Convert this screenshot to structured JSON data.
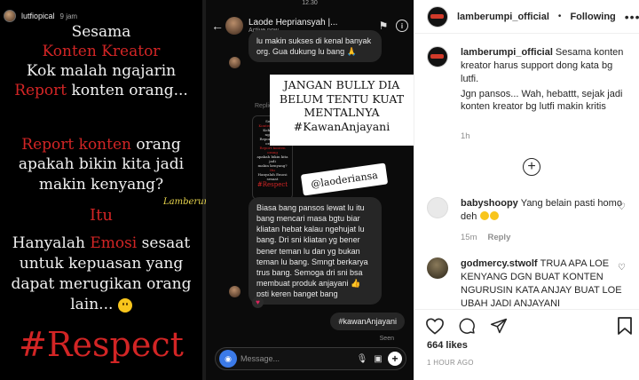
{
  "story": {
    "username": "lutfiopical",
    "time": "9 jam",
    "line1": "Sesama",
    "line2": "Konten Kreator",
    "line3": "Kok malah ngajarin",
    "line4_red": "Report",
    "line4_rest": " konten orang...",
    "line5_red": "Report konten",
    "line5_rest": " orang",
    "line6": "apakah bikin kita jadi",
    "line7": "makin kenyang?",
    "line8": "Itu",
    "line9_pre": "Hanyalah ",
    "line9_red": "Emosi",
    "line9_post": " sesaat",
    "line10": "untuk kepuasan yang",
    "line11": "dapat merugikan orang",
    "line12": "lain...",
    "hashtag": "#Respect",
    "watermark": "Lamberumpi_official"
  },
  "chat": {
    "status_time": "12.30",
    "contact_name": "Laode Hepriansyah |...",
    "active_status": "Active now",
    "bubble1": "lu makin sukses di kenal banyak org. Gua dukung lu bang 🙏",
    "reply_label": "Replied to your story",
    "thumb_lines": [
      "Sesama",
      "Konten Kreator",
      "Kok malah ngajarin",
      "Report konten orang...",
      "Report konten orang",
      "apakah bikin kita jadi",
      "makin kenyang?",
      "Itu",
      "Hanyalah Emosi sesaat",
      "#Respect"
    ],
    "overlay_quote": "JANGAN BULLY DIA BELUM TENTU KUAT MENTALNYA #KawanAnjayani",
    "tag_sticker": "@laoderiansa",
    "bubble2": "Biasa bang pansos lewat lu itu bang mencari masa bgtu biar kliatan hebat kalau ngehujat lu bang. Dri sni kliatan yg bener bener teman lu dan yg bukan teman lu bang. Smngt berkarya trus bang. Semoga dri sni bsa membuat produk anjayani 👍 psti keren banget bang",
    "sent_message": "#kawanAnjayani",
    "seen": "Seen",
    "composer_placeholder": "Message..."
  },
  "post": {
    "username": "lamberumpi_official",
    "follow_status": "Following",
    "caption_user": "lamberumpi_official",
    "caption": "Sesama konten kreator harus support dong kata bg lutfi.",
    "caption_2": "Jgn pansos... Wah, hebattt, sejak jadi konten kreator bg lutfi makin kritis",
    "caption_time": "1h",
    "comments": [
      {
        "user": "babyshoopy",
        "text": "Yang belain pasti homo deh",
        "time": "15m",
        "reply": "Reply"
      },
      {
        "user": "godmercy.stwolf",
        "text": "TRUA APA LOE KENYANG DGN BUAT KONTEN NGURUSIN KATA ANJAY BUAT LOE UBAH JADI ANJAYANI"
      }
    ],
    "likes": "664 likes",
    "time_ago": "1 HOUR AGO"
  },
  "colors": {
    "accent_red": "#d22525",
    "link_blue": "#3b7ae8",
    "text_dark": "#262626",
    "meta_gray": "#8e8e8e"
  }
}
